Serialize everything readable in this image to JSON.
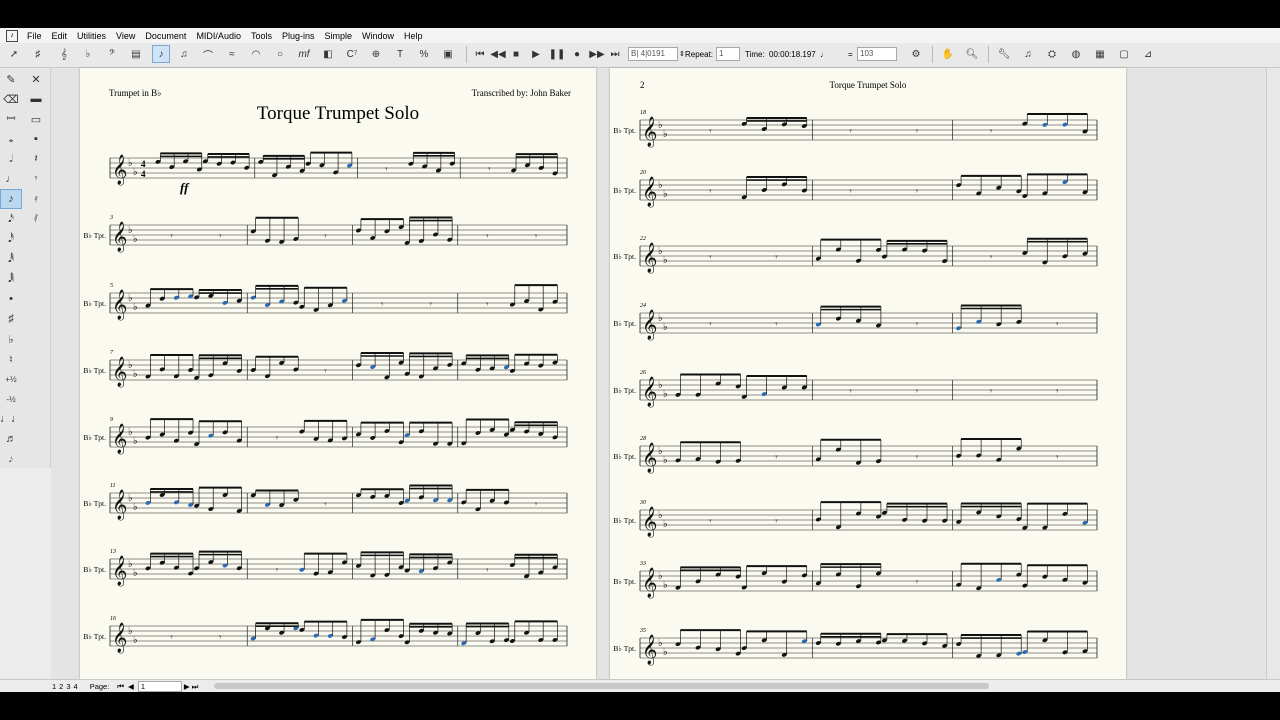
{
  "menu": [
    "File",
    "Edit",
    "Utilities",
    "View",
    "Document",
    "MIDI/Audio",
    "Tools",
    "Plug-ins",
    "Simple",
    "Window",
    "Help"
  ],
  "playback": {
    "counter": "B| 4|0191",
    "repeat_label": "Repeat:",
    "repeat_value": "1",
    "time_label": "Time:",
    "time_value": "00:00:18.197",
    "tempo_eq": "=",
    "tempo_value": "103"
  },
  "status": {
    "page_tabs": [
      "1",
      "2",
      "3",
      "4"
    ],
    "page_label": "Page:",
    "page_value": "1"
  },
  "score": {
    "title": "Torque Trumpet Solo",
    "instrument": "Trumpet in B♭",
    "transcriber": "Transcribed by: John Baker",
    "dynamic": "ff",
    "staff_label": "B♭ Tpt.",
    "page2_number": "2",
    "page2_header": "Torque Trumpet Solo",
    "page1_measure_numbers": [
      "3",
      "5",
      "7",
      "9",
      "11",
      "13",
      "16"
    ],
    "page2_measure_numbers": [
      "18",
      "20",
      "22",
      "24",
      "26",
      "28",
      "30",
      "33",
      "35"
    ]
  },
  "icons": [
    "select-icon",
    "note-entry-icon",
    "play-icon",
    "stop-icon",
    "pause-icon",
    "rewind-icon",
    "fast-forward-icon",
    "zoom-icon",
    "hand-icon"
  ],
  "colors": {
    "paper": "#fbfaf1",
    "selection": "#bcd7f0",
    "ink": "#111111"
  }
}
